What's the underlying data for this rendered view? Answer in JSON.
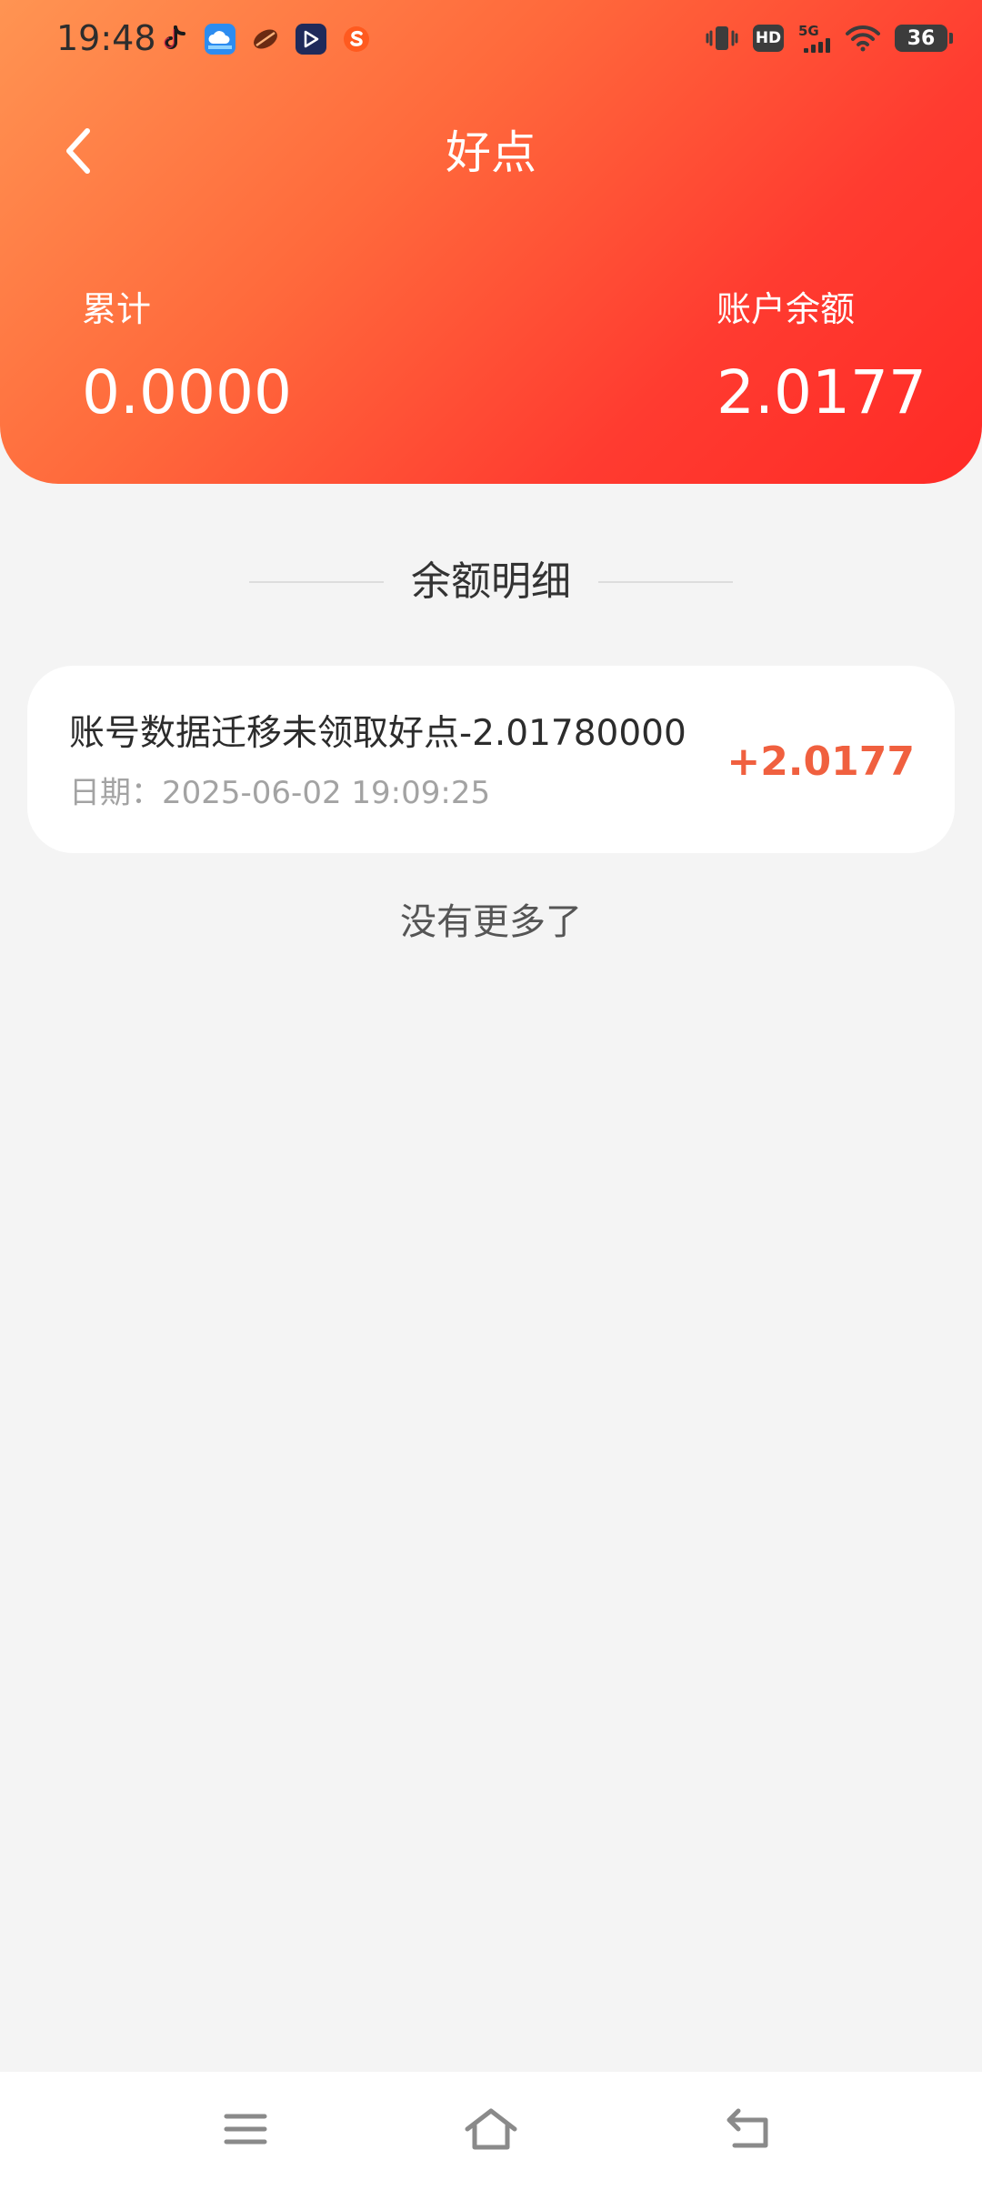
{
  "status_bar": {
    "time": "19:48",
    "apps": [
      "tiktok-icon",
      "baidu-netdisk-icon",
      "leaf-app-icon",
      "video-player-icon",
      "sogou-icon"
    ],
    "right_icons": [
      "vibrate-icon",
      "hd-icon",
      "5g-signal-icon",
      "wifi-icon",
      "battery-icon"
    ],
    "hd": "HD",
    "network": "5G",
    "battery": "36"
  },
  "header": {
    "title": "好点",
    "cumulative_label": "累计",
    "cumulative_value": "0.0000",
    "balance_label": "账户余额",
    "balance_value": "2.0177"
  },
  "section": {
    "title": "余额明细"
  },
  "records": [
    {
      "title": "账号数据迁移未领取好点-2.01780000",
      "date": "日期：2025-06-02 19:09:25",
      "amount": "+2.0177"
    }
  ],
  "footer_text": "没有更多了",
  "nav_bar": {
    "buttons": [
      "menu-icon",
      "home-icon",
      "back-icon"
    ]
  },
  "colors": {
    "header_gradient_start": "#ff9452",
    "header_gradient_end": "#ff2a26",
    "amount": "#f0603f",
    "background": "#f4f4f4"
  }
}
